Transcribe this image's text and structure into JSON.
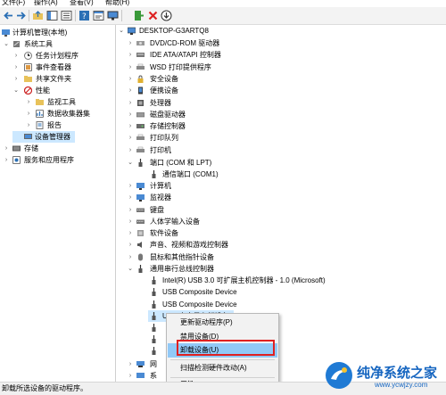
{
  "menubar": {
    "file": "文件(F)",
    "action": "操作(A)",
    "view": "查看(V)",
    "help": "帮助(H)"
  },
  "left_tree": [
    {
      "label": "计算机管理(本地)"
    },
    {
      "label": "系统工具"
    },
    {
      "label": "任务计划程序"
    },
    {
      "label": "事件查看器"
    },
    {
      "label": "共享文件夹"
    },
    {
      "label": "性能"
    },
    {
      "label": "监视工具"
    },
    {
      "label": "数据收集器集"
    },
    {
      "label": "报告"
    },
    {
      "label": "设备管理器"
    },
    {
      "label": "存储"
    },
    {
      "label": "服务和应用程序"
    }
  ],
  "right_tree": [
    {
      "label": "DESKTOP-G3ARTQ8"
    },
    {
      "label": "DVD/CD-ROM 驱动器"
    },
    {
      "label": "IDE ATA/ATAPI 控制器"
    },
    {
      "label": "WSD 打印提供程序"
    },
    {
      "label": "安全设备"
    },
    {
      "label": "便携设备"
    },
    {
      "label": "处理器"
    },
    {
      "label": "磁盘驱动器"
    },
    {
      "label": "存储控制器"
    },
    {
      "label": "打印队列"
    },
    {
      "label": "打印机"
    },
    {
      "label": "端口 (COM 和 LPT)"
    },
    {
      "label": "通信端口 (COM1)"
    },
    {
      "label": "计算机"
    },
    {
      "label": "监视器"
    },
    {
      "label": "键盘"
    },
    {
      "label": "人体学输入设备"
    },
    {
      "label": "软件设备"
    },
    {
      "label": "声音、视频和游戏控制器"
    },
    {
      "label": "鼠标和其他指针设备"
    },
    {
      "label": "通用串行总线控制器"
    },
    {
      "label": "Intel(R) USB 3.0 可扩展主机控制器 - 1.0 (Microsoft)"
    },
    {
      "label": "USB Composite Device"
    },
    {
      "label": "USB Composite Device"
    },
    {
      "label": "USB 大容量存储设备"
    },
    {
      "label": "网"
    },
    {
      "label": "系"
    }
  ],
  "context_menu": {
    "update": "更新驱动程序(P)",
    "disable": "禁用设备(D)",
    "uninstall": "卸载设备(U)",
    "scan": "扫描检测硬件改动(A)",
    "properties": "属性(R)"
  },
  "status_bar": {
    "text": "卸载所选设备的驱动程序。"
  },
  "watermark": {
    "title": "纯净系统之家",
    "url": "www.ycwjzy.com"
  },
  "colors": {
    "selection": "#cce8ff",
    "menu_highlight": "#91c9f7",
    "annotation_red": "#e02020"
  }
}
